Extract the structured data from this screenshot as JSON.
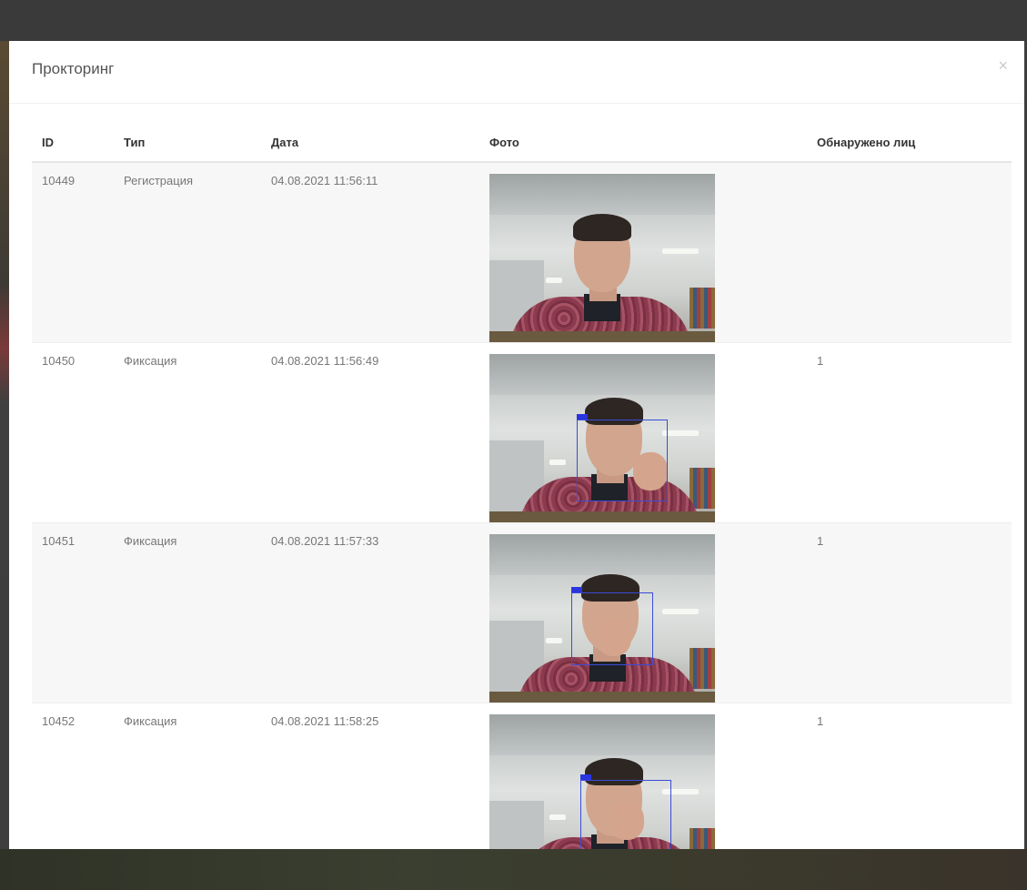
{
  "modal": {
    "title": "Прокторинг",
    "close_label": "×"
  },
  "table": {
    "headers": [
      "ID",
      "Тип",
      "Дата",
      "Фото",
      "Обнаружено лиц"
    ],
    "rows": [
      {
        "id": "10449",
        "type": "Регистрация",
        "date": "04.08.2021 11:56:11",
        "faces": ""
      },
      {
        "id": "10450",
        "type": "Фиксация",
        "date": "04.08.2021 11:56:49",
        "faces": "1"
      },
      {
        "id": "10451",
        "type": "Фиксация",
        "date": "04.08.2021 11:57:33",
        "faces": "1"
      },
      {
        "id": "10452",
        "type": "Фиксация",
        "date": "04.08.2021 11:58:25",
        "faces": "1"
      }
    ]
  }
}
